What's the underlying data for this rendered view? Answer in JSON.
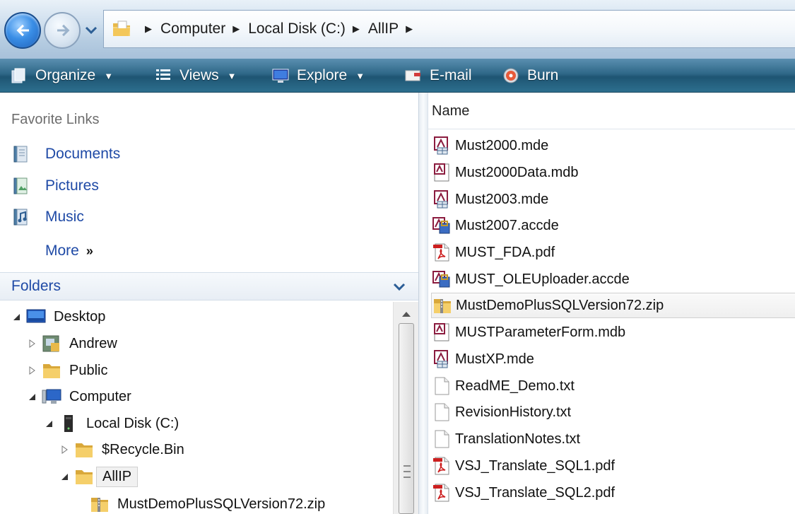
{
  "address": {
    "crumbs": [
      "Computer",
      "Local Disk (C:)",
      "AllIP"
    ]
  },
  "toolbar": {
    "organize": "Organize",
    "views": "Views",
    "explore": "Explore",
    "email": "E-mail",
    "burn": "Burn"
  },
  "favorites": {
    "heading": "Favorite Links",
    "items": [
      {
        "label": "Documents",
        "icon": "documents-icon"
      },
      {
        "label": "Pictures",
        "icon": "pictures-icon"
      },
      {
        "label": "Music",
        "icon": "music-icon"
      }
    ],
    "more": "More",
    "more_chevron": "»"
  },
  "folders": {
    "label": "Folders",
    "tree": [
      {
        "label": "Desktop",
        "icon": "desktop-icon"
      },
      {
        "label": "Andrew",
        "icon": "user-folder-icon"
      },
      {
        "label": "Public",
        "icon": "folder-icon"
      },
      {
        "label": "Computer",
        "icon": "computer-icon"
      },
      {
        "label": "Local Disk (C:)",
        "icon": "drive-icon"
      },
      {
        "label": "$Recycle.Bin",
        "icon": "folder-icon"
      },
      {
        "label": "AllIP",
        "icon": "folder-icon",
        "selected": true
      },
      {
        "label": "MustDemoPlusSQLVersion72.zip",
        "icon": "zip-folder-icon"
      }
    ]
  },
  "filelist": {
    "column": "Name",
    "files": [
      {
        "name": "Must2000.mde",
        "icon": "access-mde-icon"
      },
      {
        "name": "Must2000Data.mdb",
        "icon": "access-mdb-icon"
      },
      {
        "name": "Must2003.mde",
        "icon": "access-mde-icon"
      },
      {
        "name": "Must2007.accde",
        "icon": "access-accde-icon"
      },
      {
        "name": "MUST_FDA.pdf",
        "icon": "pdf-icon"
      },
      {
        "name": "MUST_OLEUploader.accde",
        "icon": "access-accde-icon"
      },
      {
        "name": "MustDemoPlusSQLVersion72.zip",
        "icon": "zip-folder-icon",
        "hover": true
      },
      {
        "name": "MUSTParameterForm.mdb",
        "icon": "access-mdb-icon"
      },
      {
        "name": "MustXP.mde",
        "icon": "access-mde-icon"
      },
      {
        "name": "ReadME_Demo.txt",
        "icon": "text-file-icon"
      },
      {
        "name": "RevisionHistory.txt",
        "icon": "text-file-icon"
      },
      {
        "name": "TranslationNotes.txt",
        "icon": "text-file-icon"
      },
      {
        "name": "VSJ_Translate_SQL1.pdf",
        "icon": "pdf-icon"
      },
      {
        "name": "VSJ_Translate_SQL2.pdf",
        "icon": "pdf-icon"
      }
    ]
  }
}
